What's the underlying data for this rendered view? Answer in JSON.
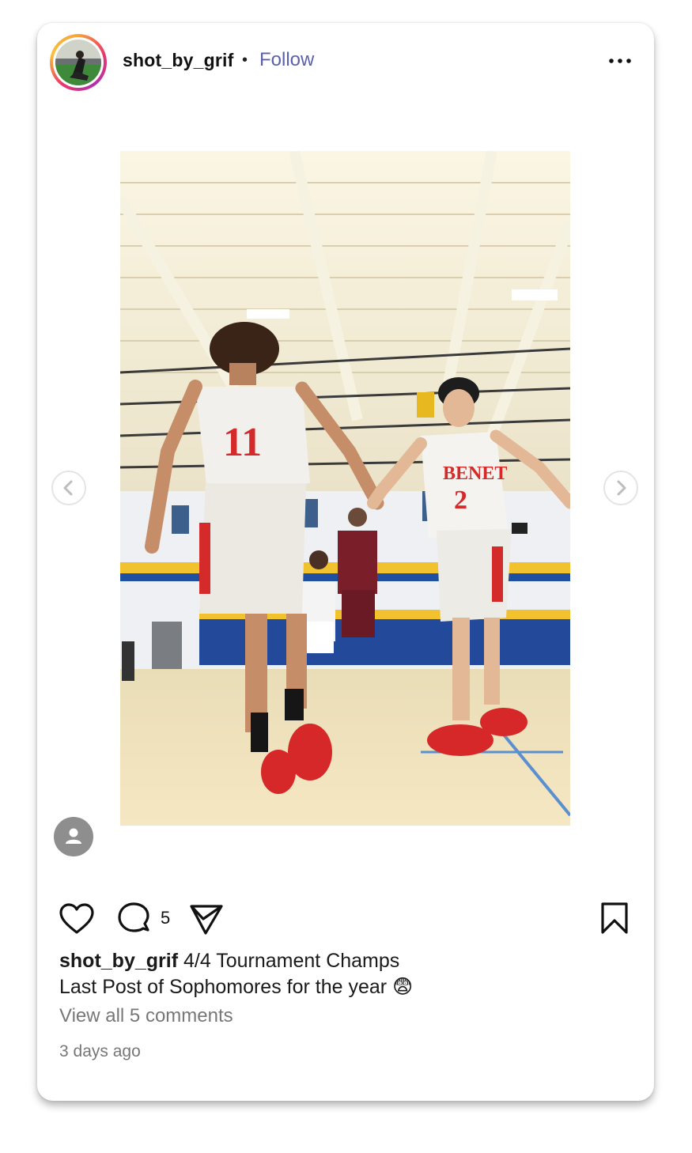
{
  "post": {
    "username": "shot_by_grif",
    "separator": "•",
    "follow_label": "Follow",
    "photo_jersey_left": "11",
    "photo_jersey_right_team": "BENET",
    "photo_jersey_right_number": "2",
    "comment_count": "5",
    "caption_user": "shot_by_grif",
    "caption_line1": "4/4 Tournament Champs",
    "caption_line2": "Last Post of Sophomores for the year",
    "caption_emoji": "😨",
    "view_comments": "View all 5 comments",
    "timestamp": "3 days ago"
  },
  "colors": {
    "follow": "#5b5fb0",
    "jersey_red": "#d42a2a",
    "court_blue": "#1f4fa0",
    "court_yellow": "#f2c12e"
  },
  "icons": {
    "more": "more-horizontal-icon",
    "prev": "chevron-left-icon",
    "next": "chevron-right-icon",
    "tag": "user-tag-icon",
    "like": "heart-icon",
    "comment": "comment-bubble-icon",
    "share": "send-icon",
    "save": "bookmark-icon"
  }
}
